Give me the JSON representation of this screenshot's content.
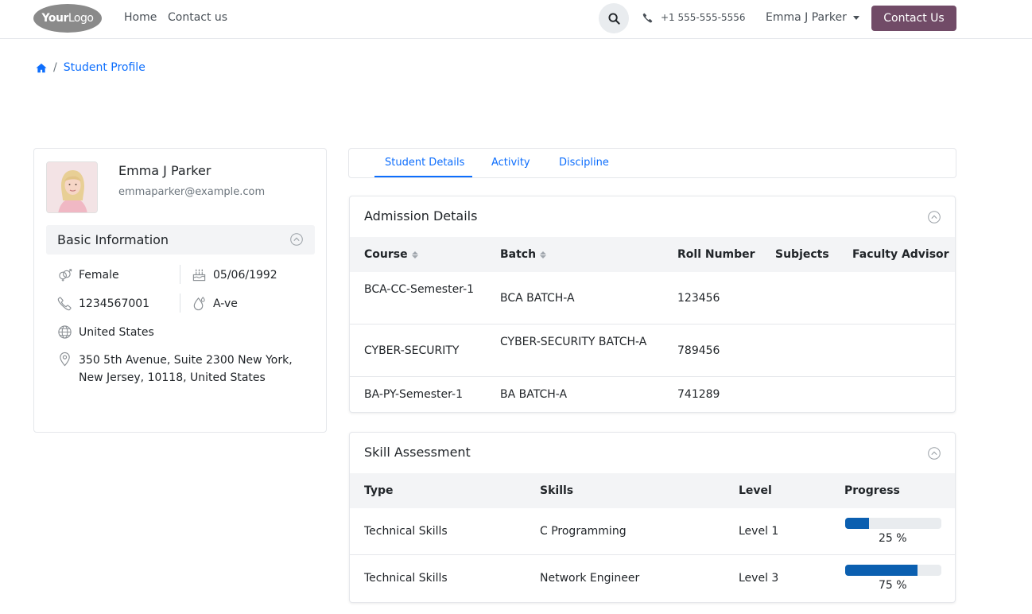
{
  "navbar": {
    "logo": {
      "bold": "Your",
      "thin": "Logo"
    },
    "links": [
      "Home",
      "Contact us"
    ],
    "phone": "+1 555-555-5556",
    "user": "Emma J Parker",
    "cta": "Contact Us",
    "cta_color": "#714b67"
  },
  "breadcrumb": {
    "current": "Student Profile"
  },
  "profile": {
    "name": "Emma J Parker",
    "email": "emmaparker@example.com",
    "basic_title": "Basic Information",
    "gender": "Female",
    "dob": "05/06/1992",
    "phone": "1234567001",
    "blood_group": "A-ve",
    "country": "United States",
    "address": "350 5th Avenue, Suite 2300 New York, New Jersey, 10118, United States"
  },
  "tabs": [
    "Student Details",
    "Activity",
    "Discipline"
  ],
  "admission": {
    "title": "Admission Details",
    "columns": [
      "Course",
      "Batch",
      "Roll Number",
      "Subjects",
      "Faculty Advisor"
    ],
    "rows": [
      {
        "course": "BCA-CC-Semester-1",
        "batch": "BCA BATCH-A",
        "roll": "123456",
        "subjects": "",
        "advisor": ""
      },
      {
        "course": "CYBER-SECURITY",
        "batch": "CYBER-SECURITY BATCH-A",
        "roll": "789456",
        "subjects": "",
        "advisor": ""
      },
      {
        "course": "BA-PY-Semester-1",
        "batch": "BA BATCH-A",
        "roll": "741289",
        "subjects": "",
        "advisor": ""
      }
    ]
  },
  "skills": {
    "title": "Skill Assessment",
    "columns": [
      "Type",
      "Skills",
      "Level",
      "Progress"
    ],
    "rows": [
      {
        "type": "Technical Skills",
        "skill": "C Programming",
        "level": "Level 1",
        "progress": 25,
        "progress_label": "25 %"
      },
      {
        "type": "Technical Skills",
        "skill": "Network Engineer",
        "level": "Level 3",
        "progress": 75,
        "progress_label": "75 %"
      }
    ],
    "bar_color": "#0b5fb0"
  }
}
